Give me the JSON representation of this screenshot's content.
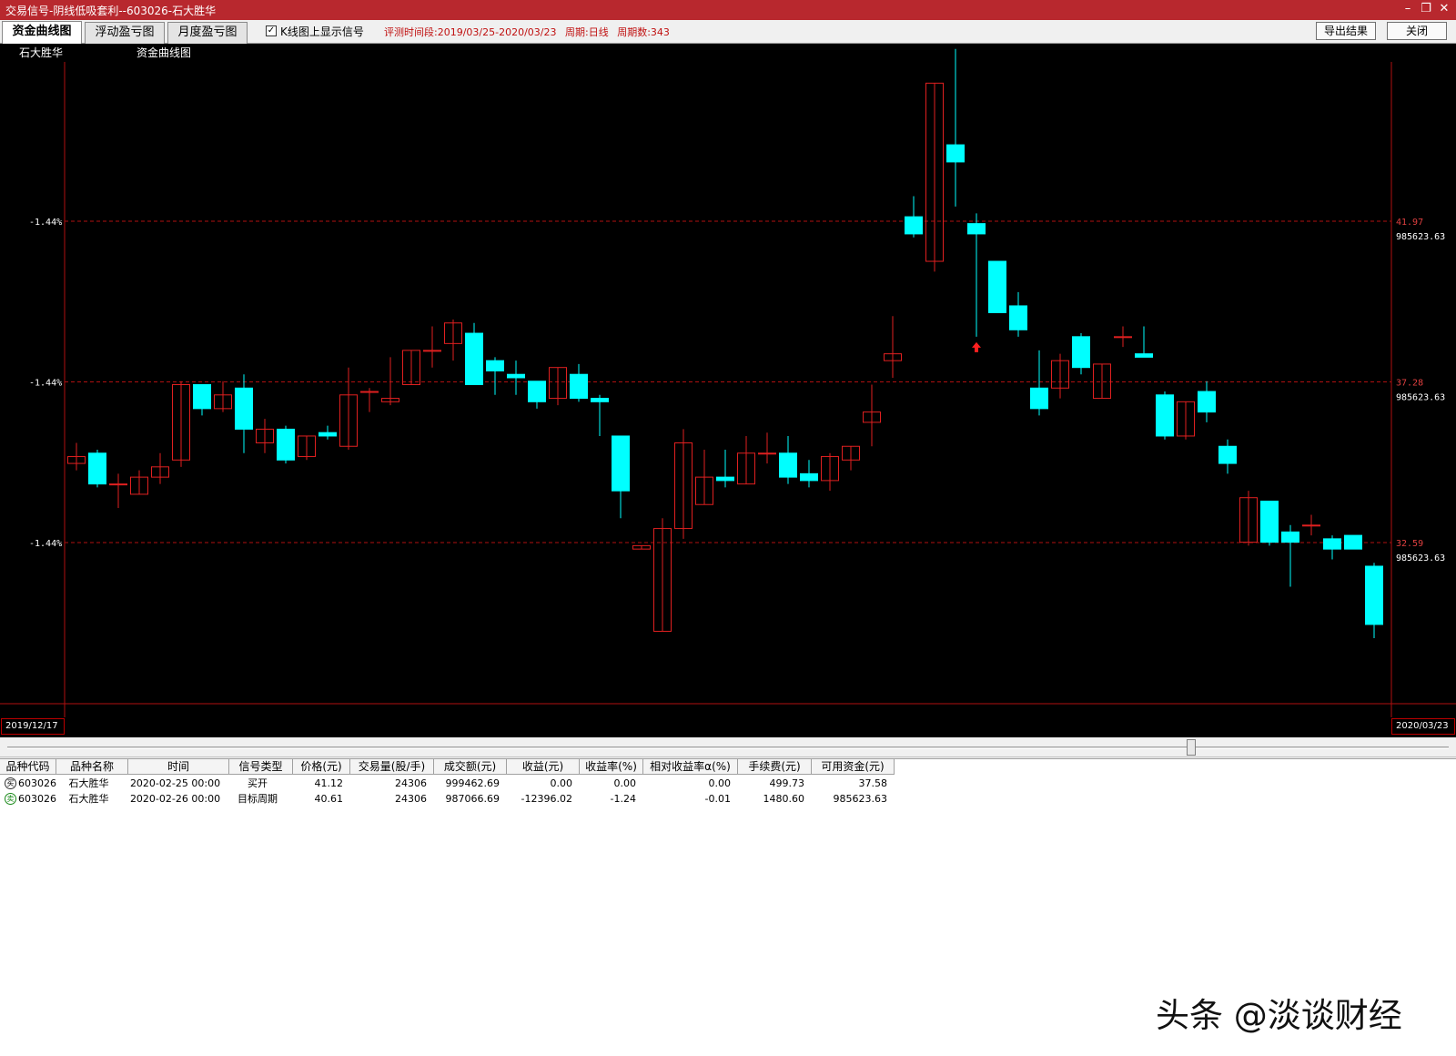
{
  "window": {
    "title": "交易信号-阴线低吸套利--603026-石大胜华",
    "min_icon": "minimize-icon",
    "max_icon": "restore-icon",
    "close_icon": "close-icon"
  },
  "toolbar": {
    "tabs": [
      {
        "label": "资金曲线图",
        "active": true
      },
      {
        "label": "浮动盈亏图",
        "active": false
      },
      {
        "label": "月度盈亏图",
        "active": false
      }
    ],
    "show_signal_checked": true,
    "show_signal_label": "K线图上显示信号",
    "eval_period": "评测时间段:2019/03/25-2020/03/23",
    "cycle": "周期:日线",
    "cycle_count": "周期数:343",
    "export_label": "导出结果",
    "close_label": "关闭"
  },
  "chart": {
    "stock_name": "石大胜华",
    "title": "资金曲线图",
    "start_date": "2019/12/17",
    "end_date": "2020/03/23",
    "left_pct_labels": [
      "-1.44%",
      "-1.44%",
      "-1.44%"
    ],
    "right_price_labels": [
      "41.97",
      "37.28",
      "32.59"
    ],
    "right_fund_labels": [
      "985623.63",
      "985623.63",
      "985623.63"
    ],
    "up_color": "#e02020",
    "down_color": "#00ffff",
    "grid_color": "#b01010"
  },
  "chart_data": {
    "type": "candlestick",
    "x_start": "2019/12/17",
    "x_end": "2020/03/23",
    "y_ticks": [
      41.97,
      37.28,
      32.59
    ],
    "candles": [
      {
        "o": 34.9,
        "c": 35.1,
        "h": 35.5,
        "l": 34.7
      },
      {
        "o": 35.2,
        "c": 34.3,
        "h": 35.3,
        "l": 34.2
      },
      {
        "o": 34.3,
        "c": 34.3,
        "h": 34.6,
        "l": 33.6
      },
      {
        "o": 34.0,
        "c": 34.5,
        "h": 34.7,
        "l": 34.0
      },
      {
        "o": 34.5,
        "c": 34.8,
        "h": 35.2,
        "l": 34.3
      },
      {
        "o": 35.0,
        "c": 37.2,
        "h": 37.3,
        "l": 34.8
      },
      {
        "o": 37.2,
        "c": 36.5,
        "h": 37.2,
        "l": 36.3
      },
      {
        "o": 36.5,
        "c": 36.9,
        "h": 37.3,
        "l": 36.4
      },
      {
        "o": 37.1,
        "c": 35.9,
        "h": 37.5,
        "l": 35.2
      },
      {
        "o": 35.5,
        "c": 35.9,
        "h": 36.2,
        "l": 35.2
      },
      {
        "o": 35.9,
        "c": 35.0,
        "h": 36.0,
        "l": 34.9
      },
      {
        "o": 35.1,
        "c": 35.7,
        "h": 35.7,
        "l": 35.0
      },
      {
        "o": 35.8,
        "c": 35.7,
        "h": 36.0,
        "l": 35.6
      },
      {
        "o": 35.4,
        "c": 36.9,
        "h": 37.7,
        "l": 35.3
      },
      {
        "o": 37.0,
        "c": 37.0,
        "h": 37.1,
        "l": 36.4
      },
      {
        "o": 36.7,
        "c": 36.8,
        "h": 38.0,
        "l": 36.6
      },
      {
        "o": 37.2,
        "c": 38.2,
        "h": 38.2,
        "l": 37.2
      },
      {
        "o": 38.2,
        "c": 38.2,
        "h": 38.9,
        "l": 37.7
      },
      {
        "o": 38.4,
        "c": 39.0,
        "h": 39.1,
        "l": 37.9
      },
      {
        "o": 38.7,
        "c": 37.2,
        "h": 39.0,
        "l": 37.2
      },
      {
        "o": 37.9,
        "c": 37.6,
        "h": 38.0,
        "l": 36.9
      },
      {
        "o": 37.5,
        "c": 37.4,
        "h": 37.9,
        "l": 36.9
      },
      {
        "o": 37.3,
        "c": 36.7,
        "h": 37.3,
        "l": 36.5
      },
      {
        "o": 36.8,
        "c": 37.7,
        "h": 37.7,
        "l": 36.6
      },
      {
        "o": 37.5,
        "c": 36.8,
        "h": 37.8,
        "l": 36.7
      },
      {
        "o": 36.8,
        "c": 36.7,
        "h": 36.9,
        "l": 35.7
      },
      {
        "o": 35.7,
        "c": 34.1,
        "h": 35.7,
        "l": 33.3
      },
      {
        "o": 32.4,
        "c": 32.5,
        "h": 32.5,
        "l": 32.4
      },
      {
        "o": 30.0,
        "c": 33.0,
        "h": 33.3,
        "l": 30.0
      },
      {
        "o": 33.0,
        "c": 35.5,
        "h": 35.9,
        "l": 32.7
      },
      {
        "o": 33.7,
        "c": 34.5,
        "h": 35.3,
        "l": 33.7
      },
      {
        "o": 34.5,
        "c": 34.4,
        "h": 35.3,
        "l": 34.2
      },
      {
        "o": 34.3,
        "c": 35.2,
        "h": 35.7,
        "l": 34.3
      },
      {
        "o": 35.2,
        "c": 35.2,
        "h": 35.8,
        "l": 34.9
      },
      {
        "o": 35.2,
        "c": 34.5,
        "h": 35.7,
        "l": 34.3
      },
      {
        "o": 34.6,
        "c": 34.4,
        "h": 35.0,
        "l": 34.2
      },
      {
        "o": 34.4,
        "c": 35.1,
        "h": 35.2,
        "l": 34.1
      },
      {
        "o": 35.0,
        "c": 35.4,
        "h": 35.4,
        "l": 34.7
      },
      {
        "o": 36.1,
        "c": 36.4,
        "h": 37.2,
        "l": 35.4
      },
      {
        "o": 37.9,
        "c": 38.1,
        "h": 39.2,
        "l": 37.4
      },
      {
        "o": 42.1,
        "c": 41.6,
        "h": 42.7,
        "l": 41.5
      },
      {
        "o": 40.8,
        "c": 46.0,
        "h": 46.0,
        "l": 40.5
      },
      {
        "o": 44.2,
        "c": 43.7,
        "h": 47.0,
        "l": 42.4
      },
      {
        "o": 41.9,
        "c": 41.6,
        "h": 42.2,
        "l": 38.6
      },
      {
        "o": 40.8,
        "c": 39.3,
        "h": 40.8,
        "l": 39.3
      },
      {
        "o": 39.5,
        "c": 38.8,
        "h": 39.9,
        "l": 38.6
      },
      {
        "o": 37.1,
        "c": 36.5,
        "h": 38.2,
        "l": 36.3
      },
      {
        "o": 37.1,
        "c": 37.9,
        "h": 38.1,
        "l": 36.8
      },
      {
        "o": 38.6,
        "c": 37.7,
        "h": 38.7,
        "l": 37.5
      },
      {
        "o": 36.8,
        "c": 37.8,
        "h": 37.8,
        "l": 36.8
      },
      {
        "o": 38.6,
        "c": 38.6,
        "h": 38.9,
        "l": 38.3
      },
      {
        "o": 38.1,
        "c": 38.0,
        "h": 38.9,
        "l": 38.0
      },
      {
        "o": 36.9,
        "c": 35.7,
        "h": 37.0,
        "l": 35.6
      },
      {
        "o": 35.7,
        "c": 36.7,
        "h": 36.7,
        "l": 35.6
      },
      {
        "o": 37.0,
        "c": 36.4,
        "h": 37.3,
        "l": 36.1
      },
      {
        "o": 35.4,
        "c": 34.9,
        "h": 35.6,
        "l": 34.6
      },
      {
        "o": 32.6,
        "c": 33.9,
        "h": 34.1,
        "l": 32.5
      },
      {
        "o": 33.8,
        "c": 32.6,
        "h": 33.8,
        "l": 32.5
      },
      {
        "o": 32.9,
        "c": 32.6,
        "h": 33.1,
        "l": 31.3
      },
      {
        "o": 33.1,
        "c": 33.1,
        "h": 33.4,
        "l": 32.8
      },
      {
        "o": 32.7,
        "c": 32.4,
        "h": 32.8,
        "l": 32.1
      },
      {
        "o": 32.8,
        "c": 32.4,
        "h": 32.8,
        "l": 32.4
      },
      {
        "o": 31.9,
        "c": 30.2,
        "h": 32.0,
        "l": 29.8
      }
    ],
    "signals": [
      {
        "index": 43,
        "type": "buy"
      }
    ]
  },
  "table": {
    "headers": [
      "品种代码",
      "品种名称",
      "时间",
      "信号类型",
      "价格(元)",
      "交易量(股/手)",
      "成交额(元)",
      "收益(元)",
      "收益率(%)",
      "相对收益率α(%)",
      "手续费(元)",
      "可用资金(元)"
    ],
    "rows": [
      {
        "icon": "buy-signal-icon",
        "icon_char": "买",
        "code": "603026",
        "name": "石大胜华",
        "time": "2020-02-25 00:00",
        "signal": "买开",
        "price": "41.12",
        "volume": "24306",
        "amount": "999462.69",
        "profit": "0.00",
        "rate": "0.00",
        "alpha": "0.00",
        "fee": "499.73",
        "cash": "37.58"
      },
      {
        "icon": "sell-signal-icon",
        "icon_char": "卖",
        "code": "603026",
        "name": "石大胜华",
        "time": "2020-02-26 00:00",
        "signal": "目标周期",
        "price": "40.61",
        "volume": "24306",
        "amount": "987066.69",
        "profit": "-12396.02",
        "rate": "-1.24",
        "alpha": "-0.01",
        "fee": "1480.60",
        "cash": "985623.63"
      }
    ]
  },
  "watermark": "头条 @淡谈财经"
}
